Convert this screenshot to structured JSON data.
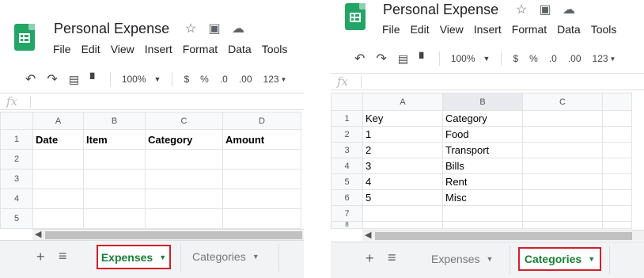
{
  "app": {
    "title": "Personal Expense",
    "menu": [
      "File",
      "Edit",
      "View",
      "Insert",
      "Format",
      "Data",
      "Tools"
    ],
    "toolbar": {
      "zoom": "100%",
      "currency": "$",
      "percent": "%",
      "decrease_decimals": ".0",
      "increase_decimals": ".00",
      "more_formats": "123"
    },
    "fx_label": "fx"
  },
  "left": {
    "columns": [
      "A",
      "B",
      "C",
      "D"
    ],
    "rows": [
      "1",
      "2",
      "3",
      "4",
      "5"
    ],
    "cells": [
      [
        "Date",
        "Item",
        "Category",
        "Amount"
      ],
      [
        "",
        "",
        "",
        ""
      ],
      [
        "",
        "",
        "",
        ""
      ],
      [
        "",
        "",
        "",
        ""
      ],
      [
        "",
        "",
        "",
        ""
      ]
    ],
    "tabs": [
      {
        "label": "Expenses",
        "active": true
      },
      {
        "label": "Categories",
        "active": false
      }
    ]
  },
  "right": {
    "columns": [
      "A",
      "B",
      "C"
    ],
    "rows": [
      "1",
      "2",
      "3",
      "4",
      "5",
      "6",
      "7",
      "8"
    ],
    "cells": [
      [
        "Key",
        "Category",
        ""
      ],
      [
        "1",
        "Food",
        ""
      ],
      [
        "2",
        "Transport",
        ""
      ],
      [
        "3",
        "Bills",
        ""
      ],
      [
        "4",
        "Rent",
        ""
      ],
      [
        "5",
        "Misc",
        ""
      ],
      [
        "",
        "",
        ""
      ],
      [
        "",
        "",
        ""
      ]
    ],
    "tabs": [
      {
        "label": "Expenses",
        "active": false
      },
      {
        "label": "Categories",
        "active": true
      }
    ]
  },
  "colors": {
    "accent_green": "#188038",
    "highlight_red": "#d21f2a",
    "sheets_logo": "#23a566"
  }
}
